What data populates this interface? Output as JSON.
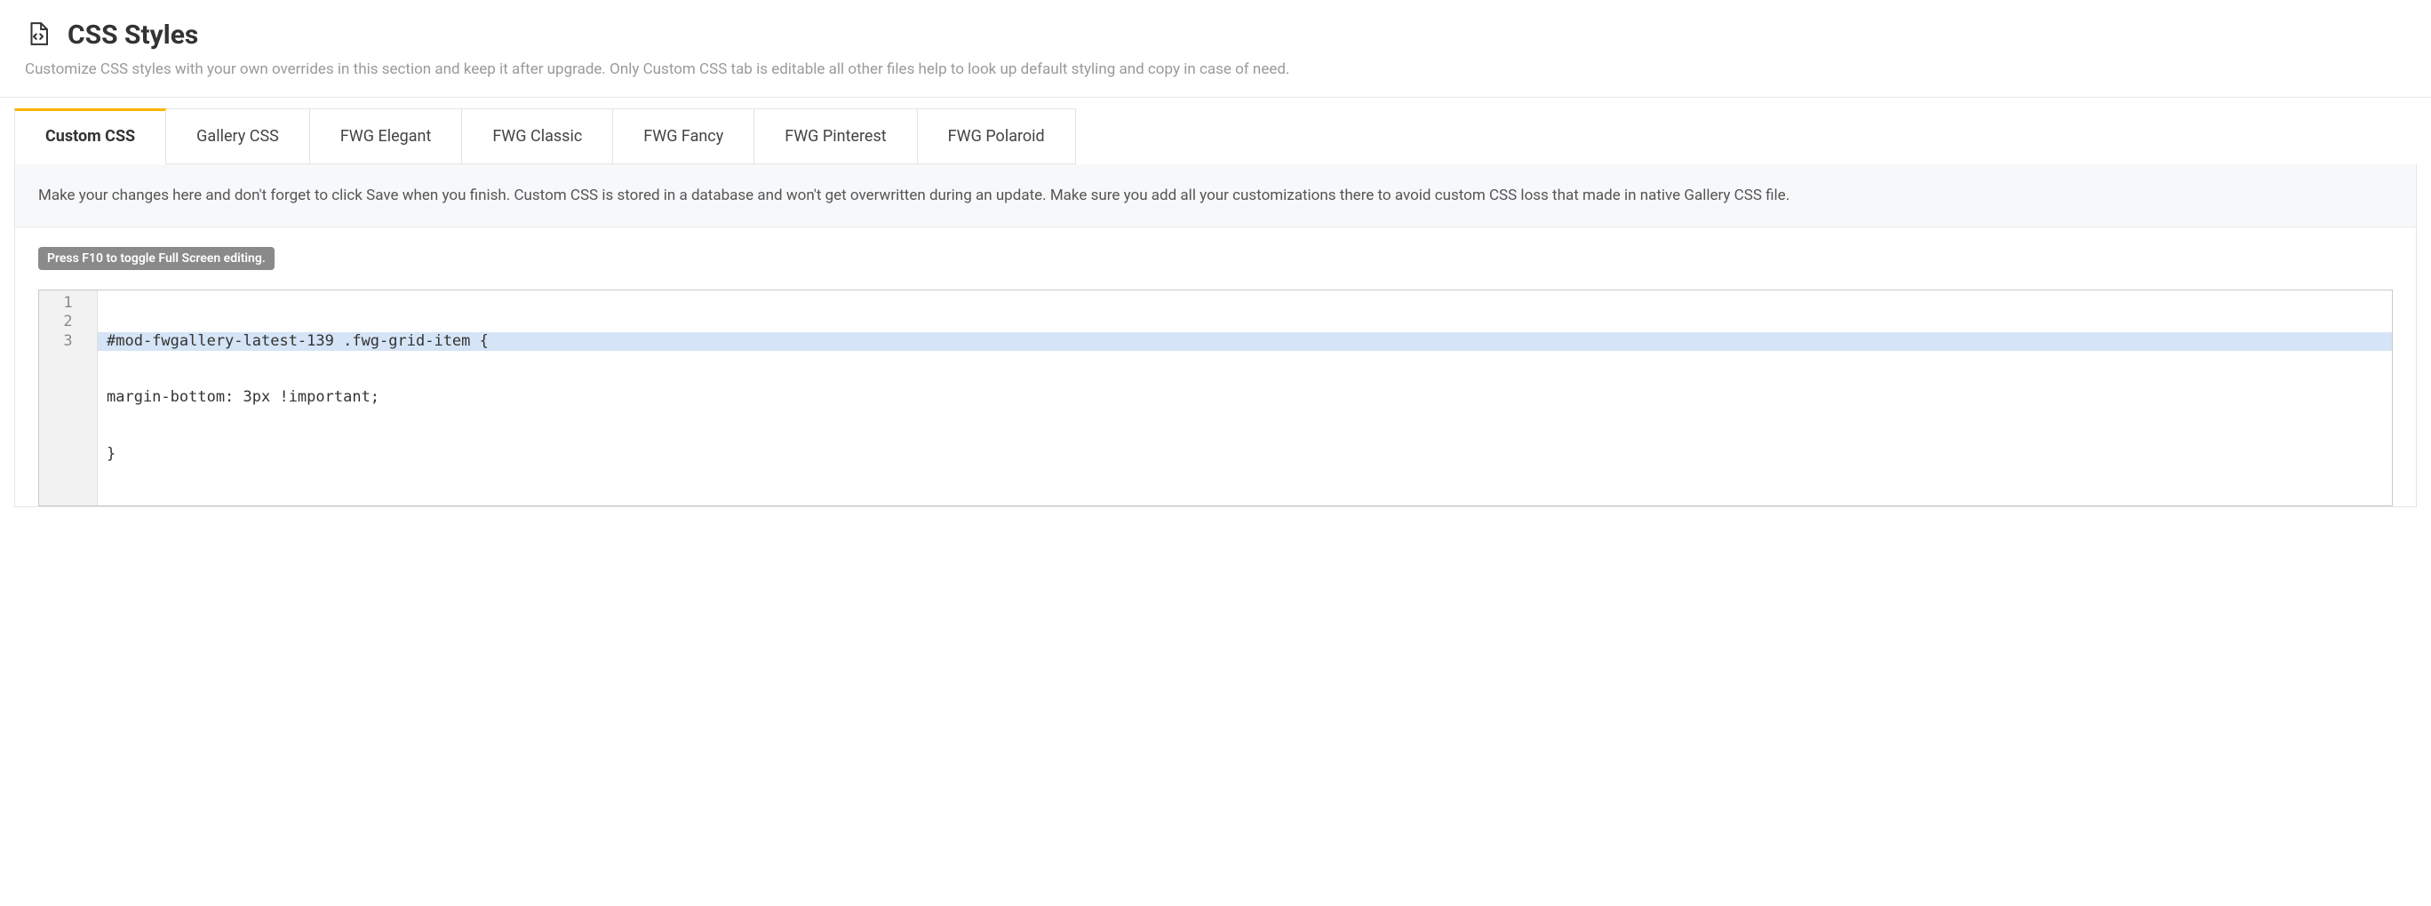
{
  "header": {
    "title": "CSS Styles",
    "description": "Customize CSS styles with your own overrides in this section and keep it after upgrade. Only Custom CSS tab is editable all other files help to look up default styling and copy in case of need."
  },
  "tabs": [
    {
      "label": "Custom CSS",
      "active": true
    },
    {
      "label": "Gallery CSS",
      "active": false
    },
    {
      "label": "FWG Elegant",
      "active": false
    },
    {
      "label": "FWG Classic",
      "active": false
    },
    {
      "label": "FWG Fancy",
      "active": false
    },
    {
      "label": "FWG Pinterest",
      "active": false
    },
    {
      "label": "FWG Polaroid",
      "active": false
    }
  ],
  "info_text": "Make your changes here and don't forget to click Save when you finish. Custom CSS is stored in a database and won't get overwritten during an update. Make sure you add all your customizations there to avoid custom CSS loss that made in native Gallery CSS file.",
  "editor": {
    "fullscreen_hint": "Press F10 to toggle Full Screen editing.",
    "line_numbers": [
      "1",
      "2",
      "3"
    ],
    "lines": [
      "#mod-fwgallery-latest-139 .fwg-grid-item {",
      "margin-bottom: 3px !important;",
      "}"
    ],
    "highlighted_line_index": 0
  }
}
